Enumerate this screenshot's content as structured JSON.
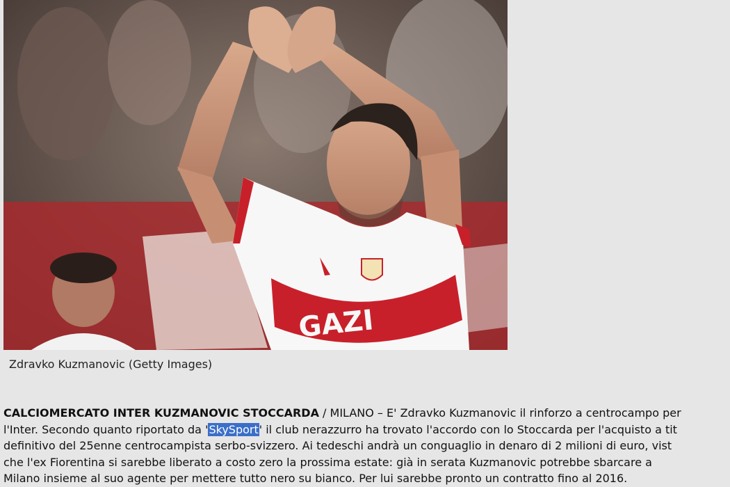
{
  "photo": {
    "alt": "Zdravko Kuzmanovic"
  },
  "caption": "Zdravko Kuzmanovic (Getty Images)",
  "article": {
    "headline": "CALCIOMERCATO INTER KUZMANOVIC STOCCARDA",
    "separator": " / ",
    "line1_rest": "MILANO – E' Zdravko Kuzmanovic il rinforzo a centrocampo per",
    "line2_before": "l'Inter.  Secondo quanto riportato da '",
    "line2_link": "SkySport",
    "line2_after": "' il club nerazzurro ha trovato l'accordo con lo Stoccarda per l'acquisto a tit",
    "line3": "definitivo del 25enne centrocampista serbo-svizzero. Ai tedeschi andrà un conguaglio in denaro di 2 milioni di euro, vist",
    "line4": "che l'ex Fiorentina si sarebbe liberato a costo zero la prossima estate: già in serata Kuzmanovic potrebbe sbarcare a",
    "line5": "Milano insieme al suo agente per mettere tutto nero su bianco. Per lui sarebbe pronto un contratto fino al 2016."
  },
  "colors": {
    "background": "#e6e6e6",
    "selection": "#3a6fc9",
    "jersey_red": "#c8202a"
  }
}
